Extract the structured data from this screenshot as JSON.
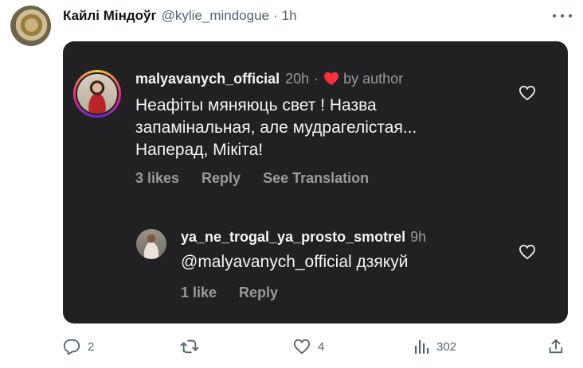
{
  "tweet": {
    "author_name": "Кайлі Міндоўг",
    "author_handle": "@kylie_mindogue",
    "separator": "·",
    "time": "1h"
  },
  "embedded": {
    "comment": {
      "username": "malyavanych_official",
      "time": "20h",
      "separator": "·",
      "by_author": "by author",
      "text": "Неафіты мяняюць свет ! Назва запамінальная, але мудрагелістая... Наперад, Мікіта!",
      "likes_label": "3 likes",
      "reply_label": "Reply",
      "translate_label": "See Translation"
    },
    "reply": {
      "username": "ya_ne_trogal_ya_prosto_smotrel",
      "time": "9h",
      "text": "@malyavanych_official дзякуй",
      "likes_label": "1 like",
      "reply_label": "Reply"
    }
  },
  "actions": {
    "replies_count": "2",
    "retweets_count": "",
    "likes_count": "4",
    "views_count": "302"
  },
  "colors": {
    "card_bg": "#212123",
    "heart_red": "#ff3040",
    "muted": "#536471"
  }
}
